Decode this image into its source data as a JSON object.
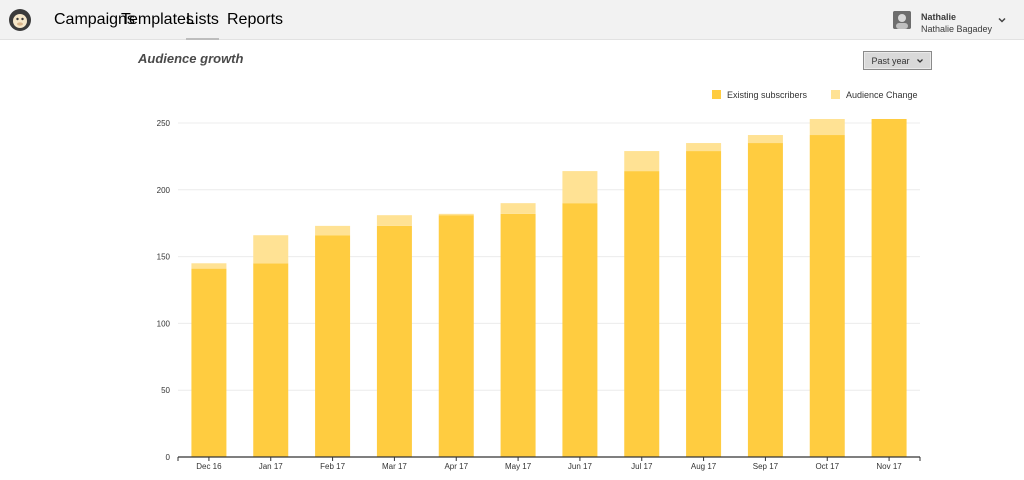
{
  "nav": {
    "items": [
      {
        "label": "Campaigns"
      },
      {
        "label": "Templates"
      },
      {
        "label": "Lists",
        "active": true
      },
      {
        "label": "Reports"
      }
    ]
  },
  "user": {
    "first_name": "Nathalie",
    "full_name": "Nathalie Bagadey",
    "avatar_icon": "user-avatar",
    "menu_icon": "chevron-down-icon"
  },
  "page": {
    "title": "Audience growth",
    "range_label": "Past year"
  },
  "colors": {
    "existing": "#ffcc40",
    "change": "#ffe294",
    "accent_nav_underline": "#bdbdbd"
  },
  "chart_data": {
    "type": "bar",
    "stacked": true,
    "categories": [
      "Dec 16",
      "Jan 17",
      "Feb 17",
      "Mar 17",
      "Apr 17",
      "May 17",
      "Jun 17",
      "Jul 17",
      "Aug 17",
      "Sep 17",
      "Oct 17",
      "Nov 17"
    ],
    "series": [
      {
        "name": "Existing subscribers",
        "values": [
          141,
          145,
          166,
          173,
          181,
          182,
          190,
          214,
          229,
          235,
          241,
          253
        ]
      },
      {
        "name": "Audience Change",
        "values": [
          4,
          21,
          7,
          8,
          1,
          8,
          24,
          15,
          6,
          6,
          12,
          0
        ]
      }
    ],
    "ylim": [
      0,
      250
    ],
    "yticks": [
      0,
      50,
      100,
      150,
      200,
      250
    ],
    "grid": true,
    "legend_position": "top-right"
  }
}
